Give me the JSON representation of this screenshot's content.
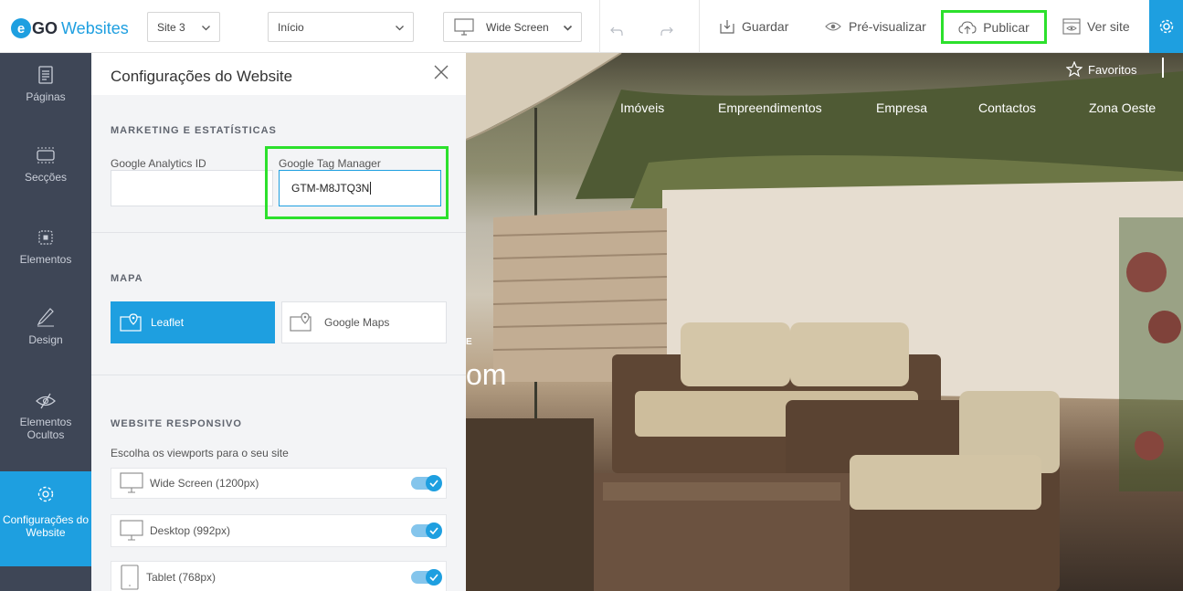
{
  "app": {
    "logo_go": "GO",
    "logo_websites": "Websites"
  },
  "topbar": {
    "site_select": "Site 3",
    "page_select": "Início",
    "view_select": "Wide Screen",
    "guardar": "Guardar",
    "pre_visualizar": "Pré-visualizar",
    "publicar": "Publicar",
    "ver_site": "Ver site"
  },
  "sidebar": {
    "items": [
      {
        "label": "Páginas",
        "icon": "document-icon"
      },
      {
        "label": "Secções",
        "icon": "sections-icon"
      },
      {
        "label": "Elementos",
        "icon": "element-icon"
      },
      {
        "label": "Design",
        "icon": "pencil-icon"
      },
      {
        "label": "Elementos Ocultos",
        "icon": "hidden-eye-icon"
      },
      {
        "label": "Configurações do Website",
        "icon": "gear-icon",
        "active": true
      }
    ]
  },
  "panel": {
    "title": "Configurações do Website",
    "marketing": {
      "title": "MARKETING E ESTATÍSTICAS",
      "ga_label": "Google Analytics ID",
      "ga_value": "",
      "gtm_label": "Google Tag Manager",
      "gtm_value": "GTM-M8JTQ3N"
    },
    "mapa": {
      "title": "MAPA",
      "options": [
        "Leaflet",
        "Google Maps"
      ],
      "selected": "Leaflet"
    },
    "responsive": {
      "title": "WEBSITE RESPONSIVO",
      "help": "Escolha os viewports para o seu site",
      "viewports": [
        {
          "label": "Wide Screen (1200px)",
          "enabled": true
        },
        {
          "label": "Desktop (992px)",
          "enabled": true
        },
        {
          "label": "Tablet (768px)",
          "enabled": true
        }
      ]
    }
  },
  "preview": {
    "favoritos": "Favoritos",
    "nav": [
      "Imóveis",
      "Empreendimentos",
      "Empresa",
      "Contactos",
      "Zona Oeste"
    ],
    "hero_fragment": "om",
    "hero_small": "E"
  },
  "colors": {
    "accent": "#1e9fe0",
    "sidebar_bg": "#3e4656",
    "highlight": "#2ce02c"
  }
}
